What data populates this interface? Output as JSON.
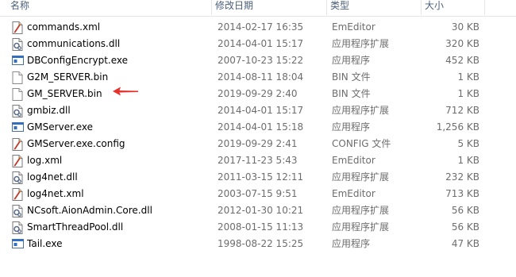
{
  "columns": {
    "name": "名称",
    "date": "修改日期",
    "type": "类型",
    "size": "大小"
  },
  "files": [
    {
      "name": "commands.xml",
      "date": "2014-02-17 16:35",
      "type": "EmEditor",
      "size": "30 KB",
      "icon": "xml-file-icon"
    },
    {
      "name": "communications.dll",
      "date": "2014-04-01 15:17",
      "type": "应用程序扩展",
      "size": "320 KB",
      "icon": "dll-file-icon"
    },
    {
      "name": "DBConfigEncrypt.exe",
      "date": "2007-10-23 15:22",
      "type": "应用程序",
      "size": "452 KB",
      "icon": "exe-file-icon"
    },
    {
      "name": "G2M_SERVER.bin",
      "date": "2014-08-11 18:04",
      "type": "BIN 文件",
      "size": "1 KB",
      "icon": "blank-file-icon"
    },
    {
      "name": "GM_SERVER.bin",
      "date": "2019-09-29 2:40",
      "type": "BIN 文件",
      "size": "1 KB",
      "icon": "blank-file-icon"
    },
    {
      "name": "gmbiz.dll",
      "date": "2014-04-01 15:17",
      "type": "应用程序扩展",
      "size": "712 KB",
      "icon": "dll-file-icon"
    },
    {
      "name": "GMServer.exe",
      "date": "2014-04-01 15:18",
      "type": "应用程序",
      "size": "1,256 KB",
      "icon": "exe-file-icon"
    },
    {
      "name": "GMServer.exe.config",
      "date": "2019-09-29 2:41",
      "type": "CONFIG 文件",
      "size": "5 KB",
      "icon": "xml-file-icon"
    },
    {
      "name": "log.xml",
      "date": "2017-11-23 5:43",
      "type": "EmEditor",
      "size": "1 KB",
      "icon": "xml-file-icon"
    },
    {
      "name": "log4net.dll",
      "date": "2011-03-15 12:11",
      "type": "应用程序扩展",
      "size": "232 KB",
      "icon": "dll-file-icon"
    },
    {
      "name": "log4net.xml",
      "date": "2003-07-15 9:51",
      "type": "EmEditor",
      "size": "713 KB",
      "icon": "xml-file-icon"
    },
    {
      "name": "NCsoft.AionAdmin.Core.dll",
      "date": "2012-01-30 10:21",
      "type": "应用程序扩展",
      "size": "56 KB",
      "icon": "dll-file-icon"
    },
    {
      "name": "SmartThreadPool.dll",
      "date": "2008-01-15 11:13",
      "type": "应用程序扩展",
      "size": "56 KB",
      "icon": "dll-file-icon"
    },
    {
      "name": "Tail.exe",
      "date": "1998-08-22 15:25",
      "type": "应用程序",
      "size": "47 KB",
      "icon": "exe-file-icon"
    }
  ],
  "colors": {
    "header_text": "#4c607a",
    "detail_text": "#6d6d6d",
    "arrow": "#e8302a"
  }
}
